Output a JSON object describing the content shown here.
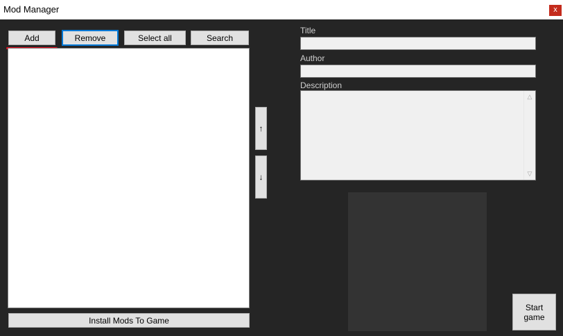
{
  "window": {
    "title": "Mod Manager",
    "close_label": "x"
  },
  "toolbar": {
    "add_label": "Add",
    "remove_label": "Remove",
    "select_all_label": "Select all",
    "search_label": "Search"
  },
  "order": {
    "up_label": "↑",
    "down_label": "↓"
  },
  "install_label": "Install Mods To Game",
  "details": {
    "title_label": "Title",
    "title_value": "",
    "author_label": "Author",
    "author_value": "",
    "description_label": "Description",
    "description_value": ""
  },
  "start_label_line1": "Start",
  "start_label_line2": "game",
  "colors": {
    "background": "#252525",
    "highlight": "#e81123",
    "focus": "#0078d7"
  }
}
